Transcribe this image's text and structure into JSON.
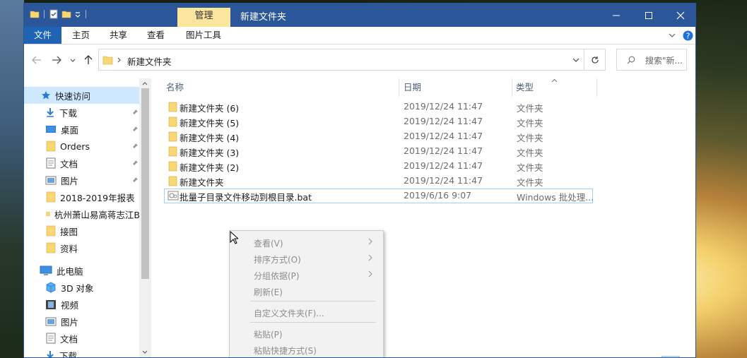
{
  "window": {
    "title": "新建文件夹",
    "manage_tab": "管理"
  },
  "ribbon": {
    "tabs": [
      "文件",
      "主页",
      "共享",
      "查看",
      "图片工具"
    ]
  },
  "address": {
    "path": "新建文件夹",
    "search_placeholder": "搜索\"新..."
  },
  "nav": {
    "quick_access": "快速访问",
    "items": [
      "下载",
      "桌面",
      "Orders",
      "文档",
      "图片",
      "2018-2019年报表",
      "杭州萧山易高蒋志江B",
      "接图",
      "资料"
    ],
    "this_pc": "此电脑",
    "pc_items": [
      "3D 对象",
      "视频",
      "图片",
      "文档",
      "下载"
    ]
  },
  "columns": {
    "name": "名称",
    "date": "日期",
    "type": "类型"
  },
  "files": [
    {
      "name": "新建文件夹 (6)",
      "date": "2019/12/24 11:47",
      "type": "文件夹"
    },
    {
      "name": "新建文件夹 (5)",
      "date": "2019/12/24 11:47",
      "type": "文件夹"
    },
    {
      "name": "新建文件夹 (4)",
      "date": "2019/12/24 11:47",
      "type": "文件夹"
    },
    {
      "name": "新建文件夹 (3)",
      "date": "2019/12/24 11:47",
      "type": "文件夹"
    },
    {
      "name": "新建文件夹 (2)",
      "date": "2019/12/24 11:47",
      "type": "文件夹"
    },
    {
      "name": "新建文件夹",
      "date": "2019/12/24 11:47",
      "type": "文件夹"
    },
    {
      "name": "批量子目录文件移动到根目录.bat",
      "date": "2019/6/16 9:07",
      "type": "Windows 批处理..."
    }
  ],
  "context_menu": {
    "view": "查看(V)",
    "sort": "排序方式(O)",
    "group": "分组依据(P)",
    "refresh": "刷新(E)",
    "customize": "自定义文件夹(F)...",
    "paste": "粘贴(P)",
    "paste_shortcut": "粘贴快捷方式(S)"
  },
  "icons": {
    "folder_color": "#f8d775",
    "accent": "#2b579a",
    "selection": "#cde8ff"
  }
}
